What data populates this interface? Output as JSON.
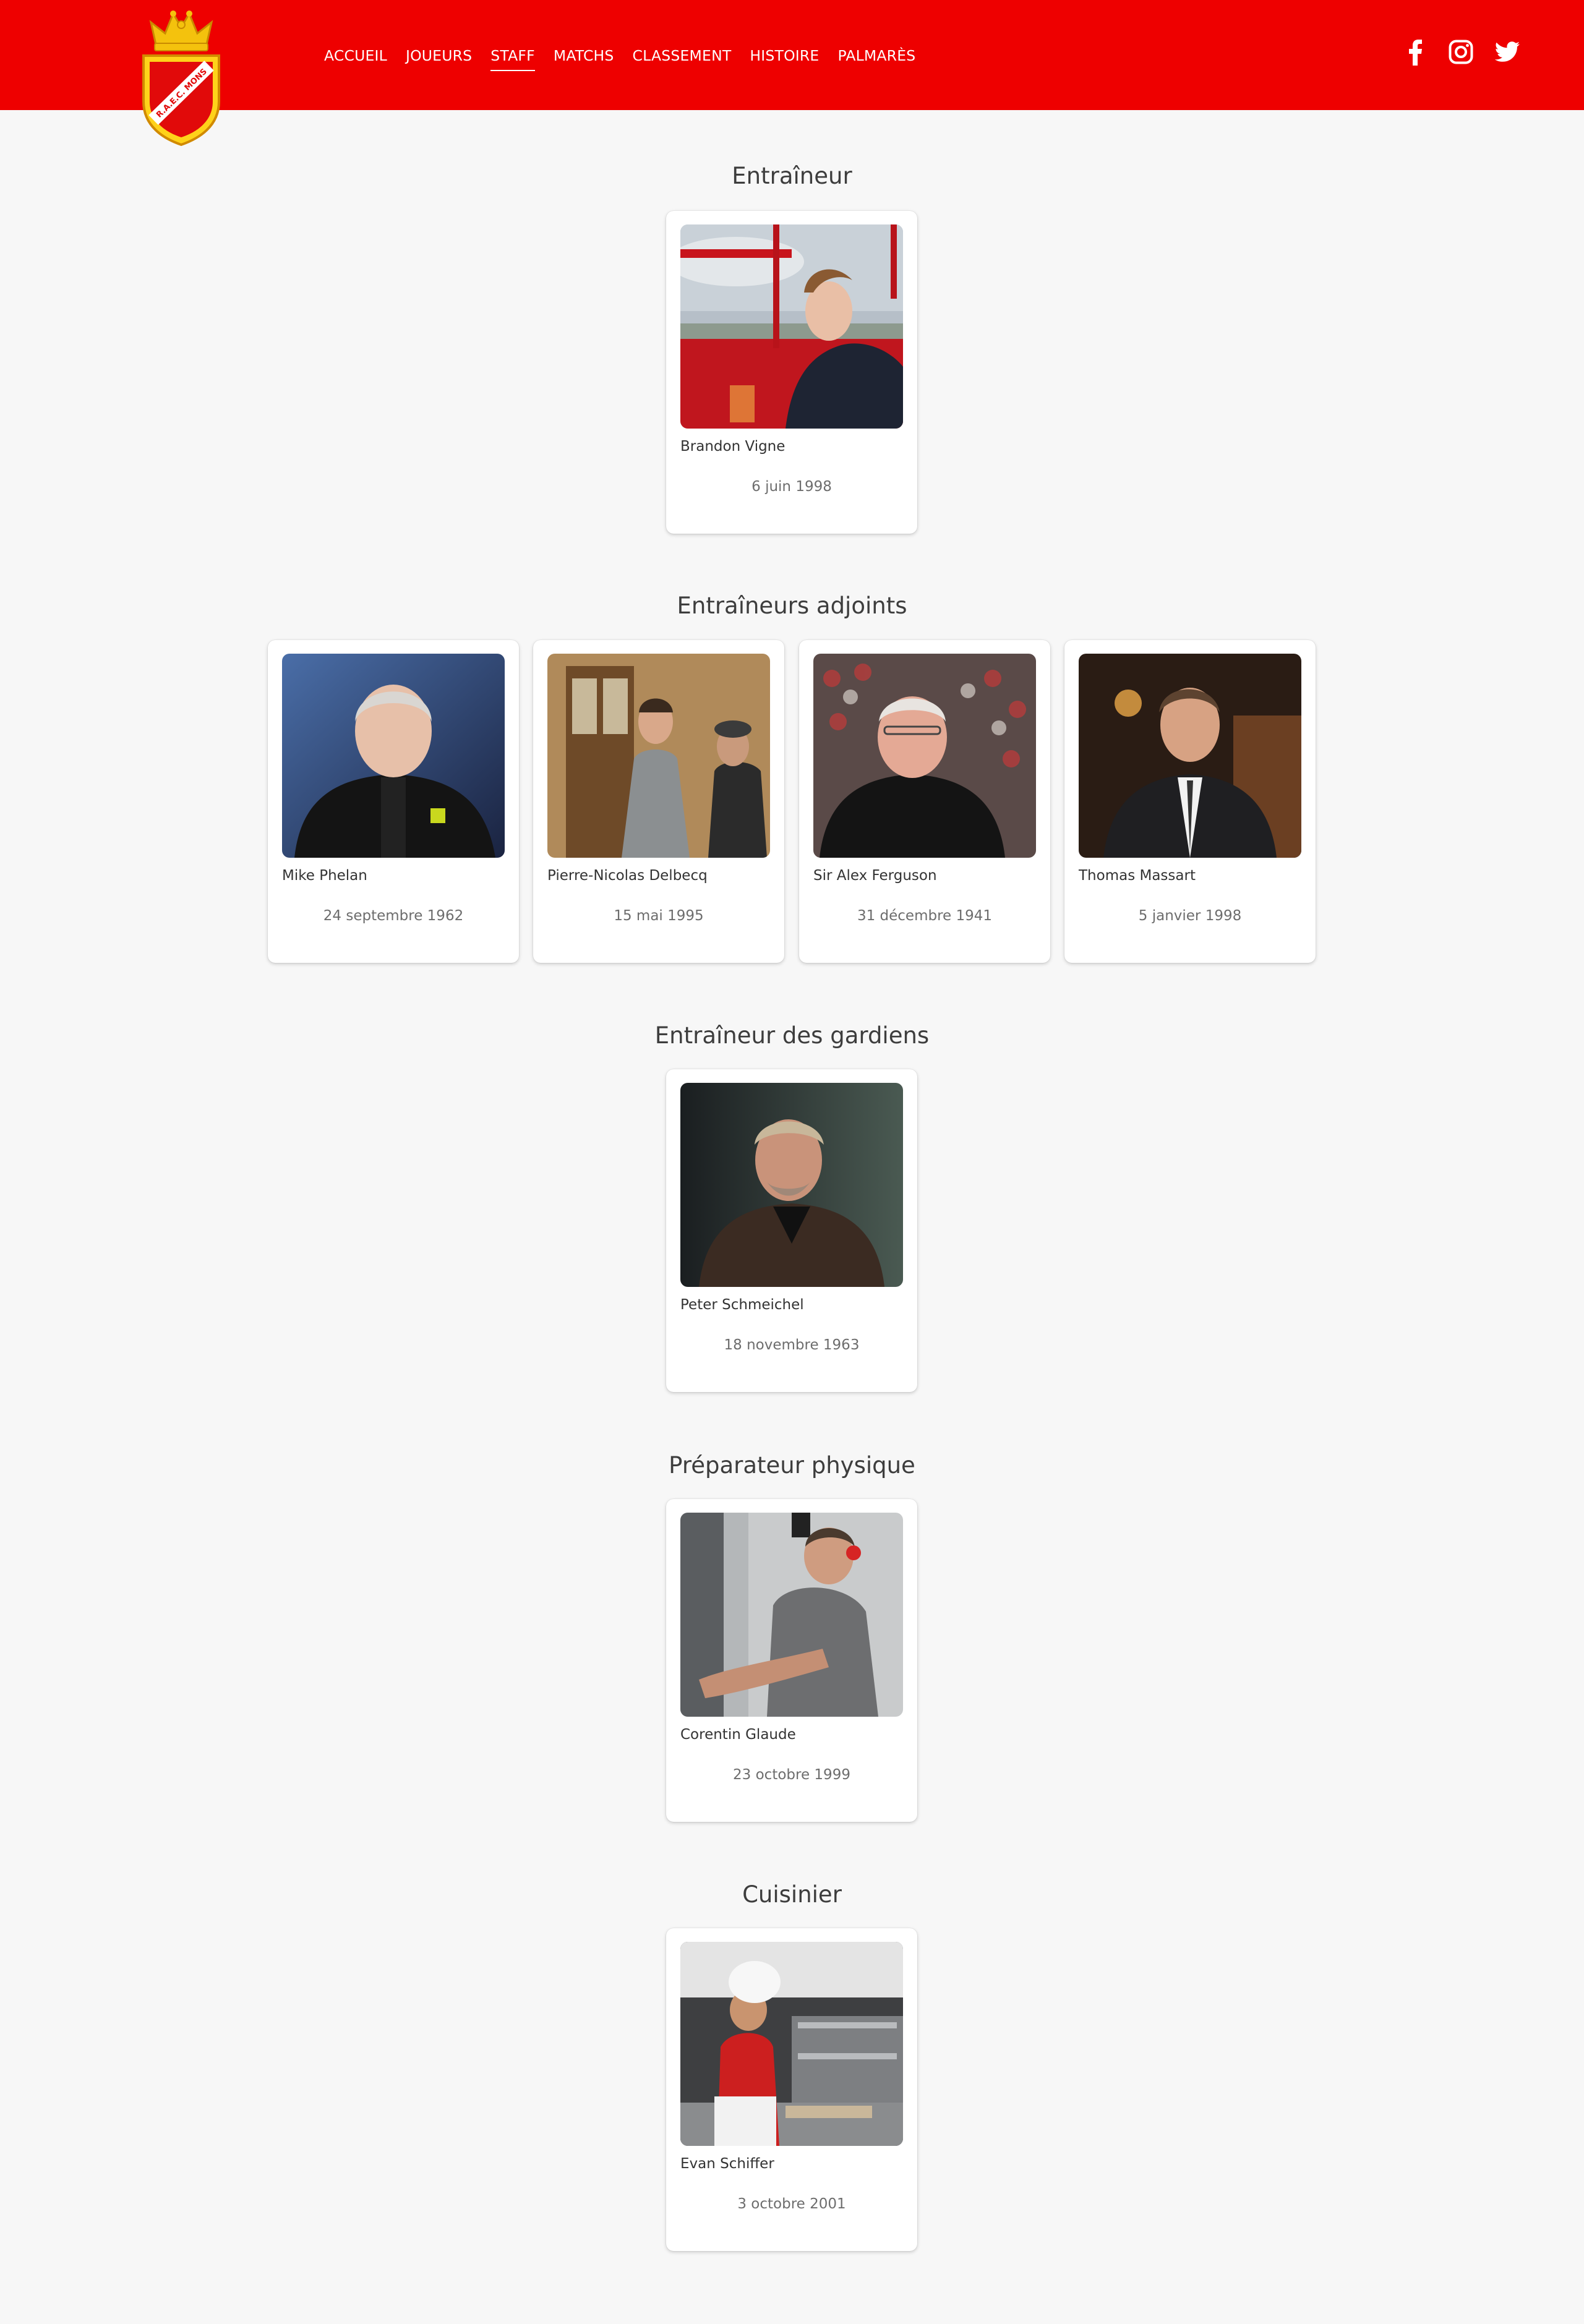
{
  "header": {
    "background": "#ee0000",
    "logo_text": "R.A.E.C. MONS",
    "nav": [
      {
        "label": "ACCUEIL"
      },
      {
        "label": "JOUEURS"
      },
      {
        "label": "STAFF",
        "active": true
      },
      {
        "label": "MATCHS"
      },
      {
        "label": "CLASSEMENT"
      },
      {
        "label": "HISTOIRE"
      },
      {
        "label": "PALMARÈS"
      }
    ],
    "social": [
      "facebook-icon",
      "instagram-icon",
      "twitter-icon"
    ]
  },
  "sections": [
    {
      "title": "Entraîneur",
      "members": [
        {
          "name": "Brandon Vigne",
          "dob": "6 juin 1998"
        }
      ]
    },
    {
      "title": "Entraîneurs adjoints",
      "members": [
        {
          "name": "Mike Phelan",
          "dob": "24 septembre 1962"
        },
        {
          "name": "Pierre-Nicolas Delbecq",
          "dob": "15 mai 1995"
        },
        {
          "name": "Sir Alex Ferguson",
          "dob": "31 décembre 1941"
        },
        {
          "name": "Thomas Massart",
          "dob": "5 janvier 1998"
        }
      ]
    },
    {
      "title": "Entraîneur des gardiens",
      "members": [
        {
          "name": "Peter Schmeichel",
          "dob": "18 novembre 1963"
        }
      ]
    },
    {
      "title": "Préparateur physique",
      "members": [
        {
          "name": "Corentin Glaude",
          "dob": "23 octobre 1999"
        }
      ]
    },
    {
      "title": "Cuisinier",
      "members": [
        {
          "name": "Evan Schiffer",
          "dob": "3 octobre 2001"
        }
      ]
    }
  ]
}
